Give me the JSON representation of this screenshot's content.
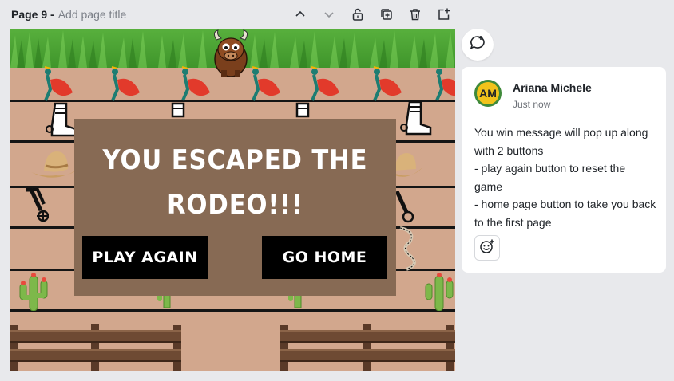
{
  "page": {
    "number_label": "Page 9 -",
    "title_placeholder": "Add page title"
  },
  "toolbar": {
    "icons": [
      "chevron-up-icon",
      "chevron-down-icon",
      "lock-icon",
      "duplicate-icon",
      "trash-icon",
      "add-page-icon"
    ]
  },
  "game": {
    "message": "YOU ESCAPED THE RODEO!!!",
    "play_again_label": "PLAY AGAIN",
    "go_home_label": "GO HOME",
    "colors": {
      "dirt": "#d2a78d",
      "popup": "#876a54",
      "button": "#000000",
      "grass": "#4aa233"
    }
  },
  "comment": {
    "avatar_initials": "AM",
    "author": "Ariana Michele",
    "time": "Just now",
    "lines": [
      "You win message will pop up along with 2 buttons",
      "- play again button to reset the game",
      "- home page button to take you back to the first page"
    ]
  }
}
